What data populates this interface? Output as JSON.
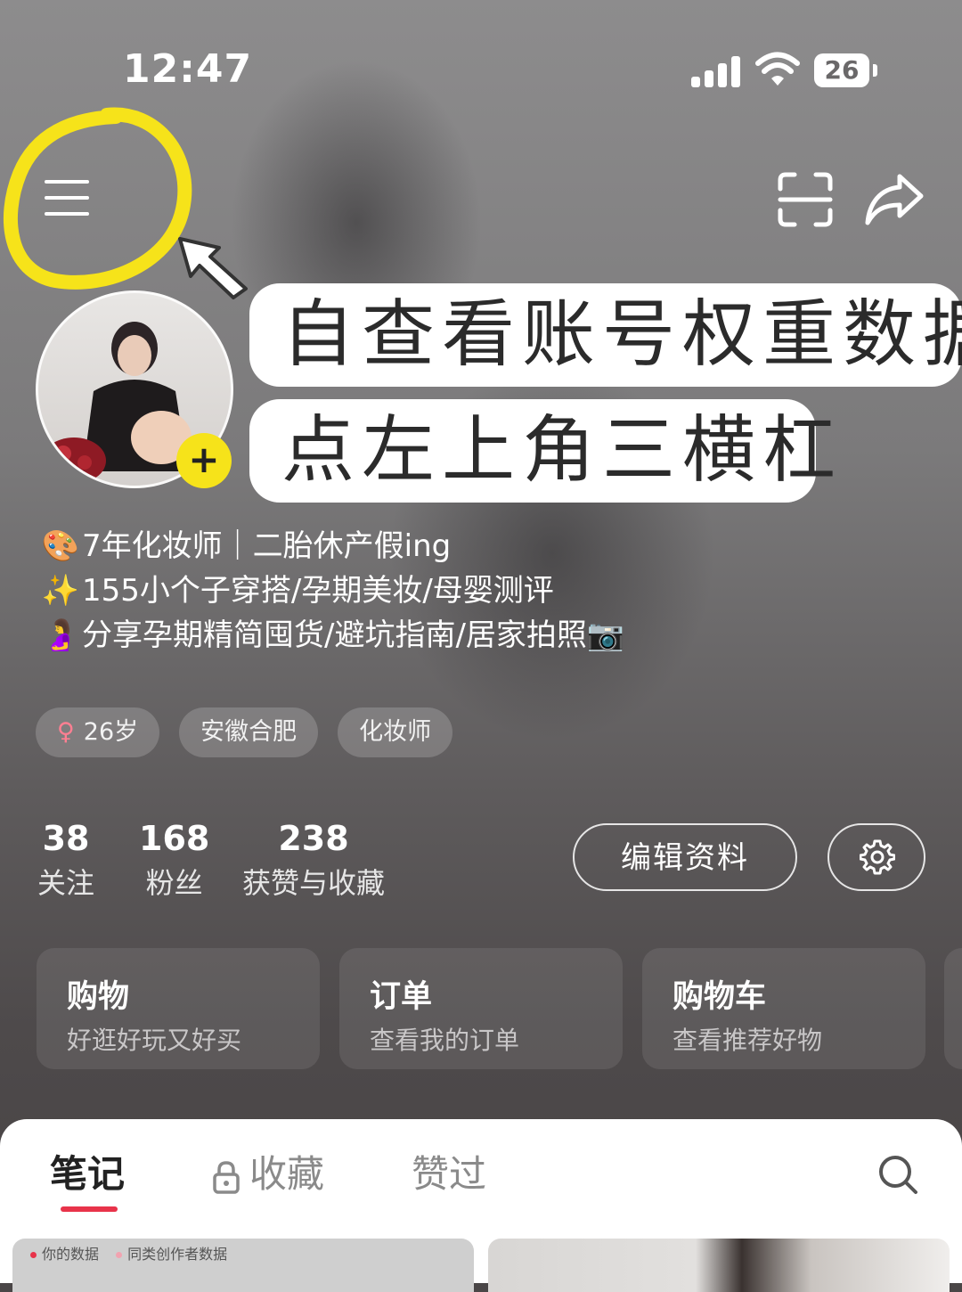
{
  "status_bar": {
    "time": "12:47",
    "battery": "26"
  },
  "overlay": {
    "callout_1": "自查看账号权重数据",
    "callout_2": "点左上角三横杠"
  },
  "profile": {
    "bio": [
      {
        "emoji": "🎨",
        "text": "7年化妆师｜二胎休产假ing"
      },
      {
        "emoji": "✨",
        "text": "155小个子穿搭/孕期美妆/母婴测评"
      },
      {
        "emoji": "🤰",
        "text": "分享孕期精简囤货/避坑指南/居家拍照📷"
      }
    ],
    "tags": [
      {
        "icon": "female-symbol",
        "symbol": "♀",
        "label": "26岁"
      },
      {
        "label": "安徽合肥"
      },
      {
        "label": "化妆师"
      }
    ],
    "stats": [
      {
        "value": "38",
        "label": "关注"
      },
      {
        "value": "168",
        "label": "粉丝"
      },
      {
        "value": "238",
        "label": "获赞与收藏"
      }
    ],
    "edit_button": "编辑资料",
    "avatar_plus": "+"
  },
  "cards": [
    {
      "title": "购物",
      "subtitle": "好逛好玩又好买"
    },
    {
      "title": "订单",
      "subtitle": "查看我的订单"
    },
    {
      "title": "购物车",
      "subtitle": "查看推荐好物"
    }
  ],
  "tabs": [
    {
      "label": "笔记",
      "active": true
    },
    {
      "label": "收藏",
      "icon": "lock-icon"
    },
    {
      "label": "赞过"
    }
  ],
  "notes": {
    "legend_mine": "你的数据",
    "legend_peer": "同类创作者数据"
  },
  "colors": {
    "accent": "#e8334a",
    "highlight": "#f6e31a",
    "tab_indicator": "#e8334a"
  }
}
